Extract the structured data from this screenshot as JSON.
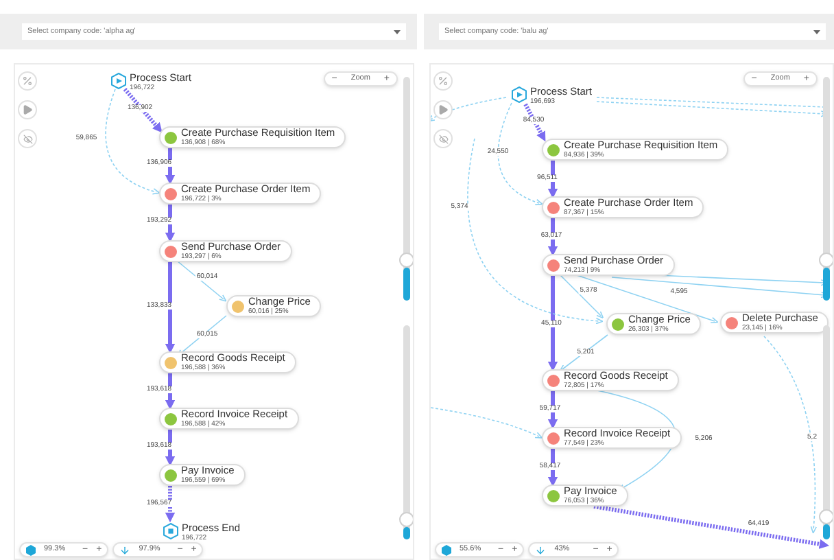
{
  "panels": [
    {
      "company_select": {
        "value": "Select company code: 'alpha ag'"
      },
      "zoom": {
        "minus": "−",
        "label": "Zoom",
        "plus": "+"
      },
      "nodes": [
        {
          "kind": "start",
          "name": "Process Start",
          "stats": "196,722"
        },
        {
          "kind": "activity",
          "name": "Create Purchase Requisition Item",
          "stats": "136,908 | 68%",
          "color": "#8cc63f"
        },
        {
          "kind": "activity",
          "name": "Create Purchase Order Item",
          "stats": "196,722 | 3%",
          "color": "#f5837b"
        },
        {
          "kind": "activity",
          "name": "Send Purchase Order",
          "stats": "193,297 | 6%",
          "color": "#f5837b"
        },
        {
          "kind": "activity",
          "name": "Change Price",
          "stats": "60,016 | 25%",
          "color": "#f0c36d"
        },
        {
          "kind": "activity",
          "name": "Record Goods Receipt",
          "stats": "196,588 | 36%",
          "color": "#f0c36d"
        },
        {
          "kind": "activity",
          "name": "Record Invoice Receipt",
          "stats": "196,588 | 42%",
          "color": "#8cc63f"
        },
        {
          "kind": "activity",
          "name": "Pay Invoice",
          "stats": "196,559 | 69%",
          "color": "#8cc63f"
        },
        {
          "kind": "end",
          "name": "Process End",
          "stats": "196,722"
        }
      ],
      "edges": [
        {
          "kind": "main-dashed",
          "label": "136,902"
        },
        {
          "kind": "light-dashed",
          "label": "59,865"
        },
        {
          "kind": "main",
          "label": "136,906"
        },
        {
          "kind": "main",
          "label": "193,292"
        },
        {
          "kind": "light",
          "label": "60,014"
        },
        {
          "kind": "main",
          "label": "133,833"
        },
        {
          "kind": "light",
          "label": "60,015"
        },
        {
          "kind": "main",
          "label": "193,618"
        },
        {
          "kind": "main",
          "label": "193,618"
        },
        {
          "kind": "main-dashed",
          "label": "196,567"
        }
      ],
      "sliders": [
        {
          "level": 0.15
        },
        {
          "level": 0.06
        }
      ],
      "activity_control": {
        "value": "99.3%",
        "minus": "−",
        "plus": "+"
      },
      "path_control": {
        "value": "97.9%",
        "minus": "−",
        "plus": "+"
      }
    },
    {
      "company_select": {
        "value": "Select company code: 'balu ag'"
      },
      "zoom": {
        "minus": "−",
        "label": "Zoom",
        "plus": "+"
      },
      "nodes": [
        {
          "kind": "start",
          "name": "Process Start",
          "stats": "196,693"
        },
        {
          "kind": "activity",
          "name": "Create Purchase Requisition Item",
          "stats": "84,936 | 39%",
          "color": "#8cc63f"
        },
        {
          "kind": "activity",
          "name": "Create Purchase Order Item",
          "stats": "87,367 | 15%",
          "color": "#f5837b"
        },
        {
          "kind": "activity",
          "name": "Send Purchase Order",
          "stats": "74,213 | 9%",
          "color": "#f5837b"
        },
        {
          "kind": "activity",
          "name": "Change Price",
          "stats": "26,303 | 37%",
          "color": "#8cc63f"
        },
        {
          "kind": "activity",
          "name": "Delete Purchase",
          "stats": "23,145 | 16%",
          "color": "#f5837b"
        },
        {
          "kind": "activity",
          "name": "Record Goods Receipt",
          "stats": "72,805 | 17%",
          "color": "#f5837b"
        },
        {
          "kind": "activity",
          "name": "Record Invoice Receipt",
          "stats": "77,549 | 23%",
          "color": "#f5837b"
        },
        {
          "kind": "activity",
          "name": "Pay Invoice",
          "stats": "76,053 | 36%",
          "color": "#8cc63f"
        }
      ],
      "edges": [
        {
          "kind": "main-dashed",
          "label": "84,530"
        },
        {
          "kind": "light-dashed",
          "label": "24,550"
        },
        {
          "kind": "main",
          "label": "96,511"
        },
        {
          "kind": "main",
          "label": "63,017"
        },
        {
          "kind": "light",
          "label": "5,378"
        },
        {
          "kind": "light",
          "label": "4,595"
        },
        {
          "kind": "main",
          "label": "45,110"
        },
        {
          "kind": "light",
          "label": "5,201"
        },
        {
          "kind": "main",
          "label": "59,717"
        },
        {
          "kind": "main",
          "label": "58,417"
        },
        {
          "kind": "light",
          "label": "5,206"
        },
        {
          "kind": "main-dashed",
          "label": "64,419"
        },
        {
          "kind": "light-dashed"
        },
        {
          "kind": "light-dashed"
        },
        {
          "kind": "light-dashed",
          "label": "5,374"
        },
        {
          "kind": "light-dashed"
        },
        {
          "kind": "light"
        },
        {
          "kind": "light"
        },
        {
          "kind": "light-dashed",
          "label": "5,2"
        }
      ],
      "sliders": [
        {
          "level": 0.15
        },
        {
          "level": 0.07
        }
      ],
      "activity_control": {
        "value": "55.6%",
        "minus": "−",
        "plus": "+"
      },
      "path_control": {
        "value": "43%",
        "minus": "−",
        "plus": "+"
      }
    }
  ]
}
